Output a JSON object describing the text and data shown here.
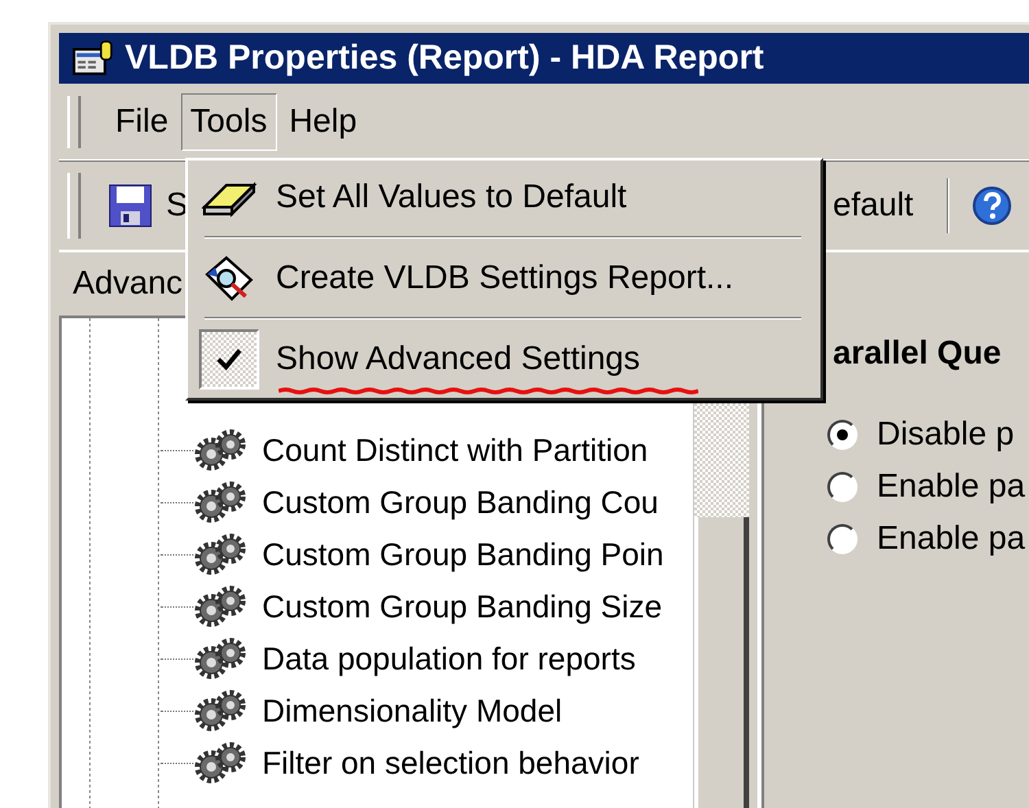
{
  "window": {
    "title": "VLDB Properties (Report) - HDA Report"
  },
  "menu_bar": [
    {
      "label": "File",
      "selected": false
    },
    {
      "label": "Tools",
      "selected": true
    },
    {
      "label": "Help",
      "selected": false
    }
  ],
  "toolbar": {
    "save_label": "S",
    "default_label": "efault"
  },
  "section_label": "Advanc",
  "tools_menu": [
    {
      "label": "Set All Values to Default",
      "kind": "eraser",
      "checked": false
    },
    {
      "label": "Create VLDB Settings Report...",
      "kind": "report",
      "checked": false
    },
    {
      "label": "Show Advanced Settings",
      "kind": "check",
      "checked": true
    }
  ],
  "tree": {
    "items": [
      {
        "label": "Count Distinct with Partition"
      },
      {
        "label": "Custom Group Banding Cou"
      },
      {
        "label": "Custom Group Banding Poin"
      },
      {
        "label": "Custom Group Banding Size"
      },
      {
        "label": "Data population for reports"
      },
      {
        "label": "Dimensionality Model"
      },
      {
        "label": "Filter on selection behavior"
      }
    ]
  },
  "settings_panel": {
    "heading": "arallel Que",
    "options": [
      {
        "label": "Disable p",
        "selected": true
      },
      {
        "label": "Enable pa",
        "selected": false
      },
      {
        "label": "Enable pa",
        "selected": false
      }
    ]
  }
}
